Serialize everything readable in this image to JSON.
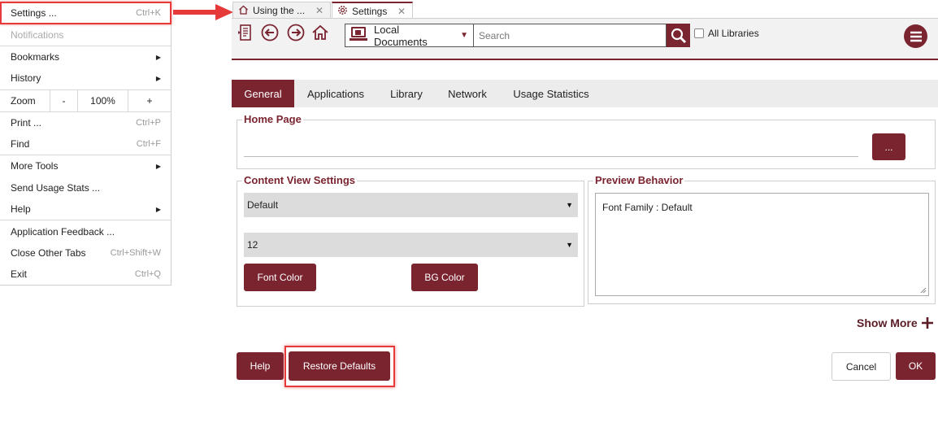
{
  "menu": {
    "items": [
      {
        "label": "Settings ...",
        "shortcut": "Ctrl+K"
      },
      {
        "label": "Notifications",
        "shortcut": ""
      },
      {
        "label": "Bookmarks",
        "shortcut": ""
      },
      {
        "label": "History",
        "shortcut": ""
      },
      {
        "label": "Print ...",
        "shortcut": "Ctrl+P"
      },
      {
        "label": "Find",
        "shortcut": "Ctrl+F"
      },
      {
        "label": "More Tools",
        "shortcut": ""
      },
      {
        "label": "Send Usage Stats ...",
        "shortcut": ""
      },
      {
        "label": "Help",
        "shortcut": ""
      },
      {
        "label": "Application Feedback ...",
        "shortcut": ""
      },
      {
        "label": "Close Other Tabs",
        "shortcut": "Ctrl+Shift+W"
      },
      {
        "label": "Exit",
        "shortcut": "Ctrl+Q"
      }
    ],
    "zoom": {
      "label": "Zoom",
      "minus": "-",
      "value": "100%",
      "plus": "+"
    },
    "submenu_arrow": "▶"
  },
  "tabs": [
    {
      "label": "Using the ...",
      "icon": "home-icon",
      "close": "✕"
    },
    {
      "label": "Settings",
      "icon": "gear-icon",
      "close": "✕"
    }
  ],
  "toolbar": {
    "location": "Local Documents",
    "search_placeholder": "Search",
    "all_libraries": "All Libraries"
  },
  "settings_tabs": [
    "General",
    "Applications",
    "Library",
    "Network",
    "Usage Statistics"
  ],
  "home_page": {
    "legend": "Home Page",
    "value": "",
    "browse_label": "..."
  },
  "content_view": {
    "legend": "Content View Settings",
    "font_family": "Default",
    "font_size": "12",
    "font_color_label": "Font Color",
    "bg_color_label": "BG Color"
  },
  "preview": {
    "legend": "Preview Behavior",
    "text": "Font Family : Default"
  },
  "show_more": "Show More",
  "buttons": {
    "help": "Help",
    "restore": "Restore Defaults",
    "cancel": "Cancel",
    "ok": "OK"
  },
  "colors": {
    "accent": "#7a2430",
    "highlight": "#e5393a"
  }
}
